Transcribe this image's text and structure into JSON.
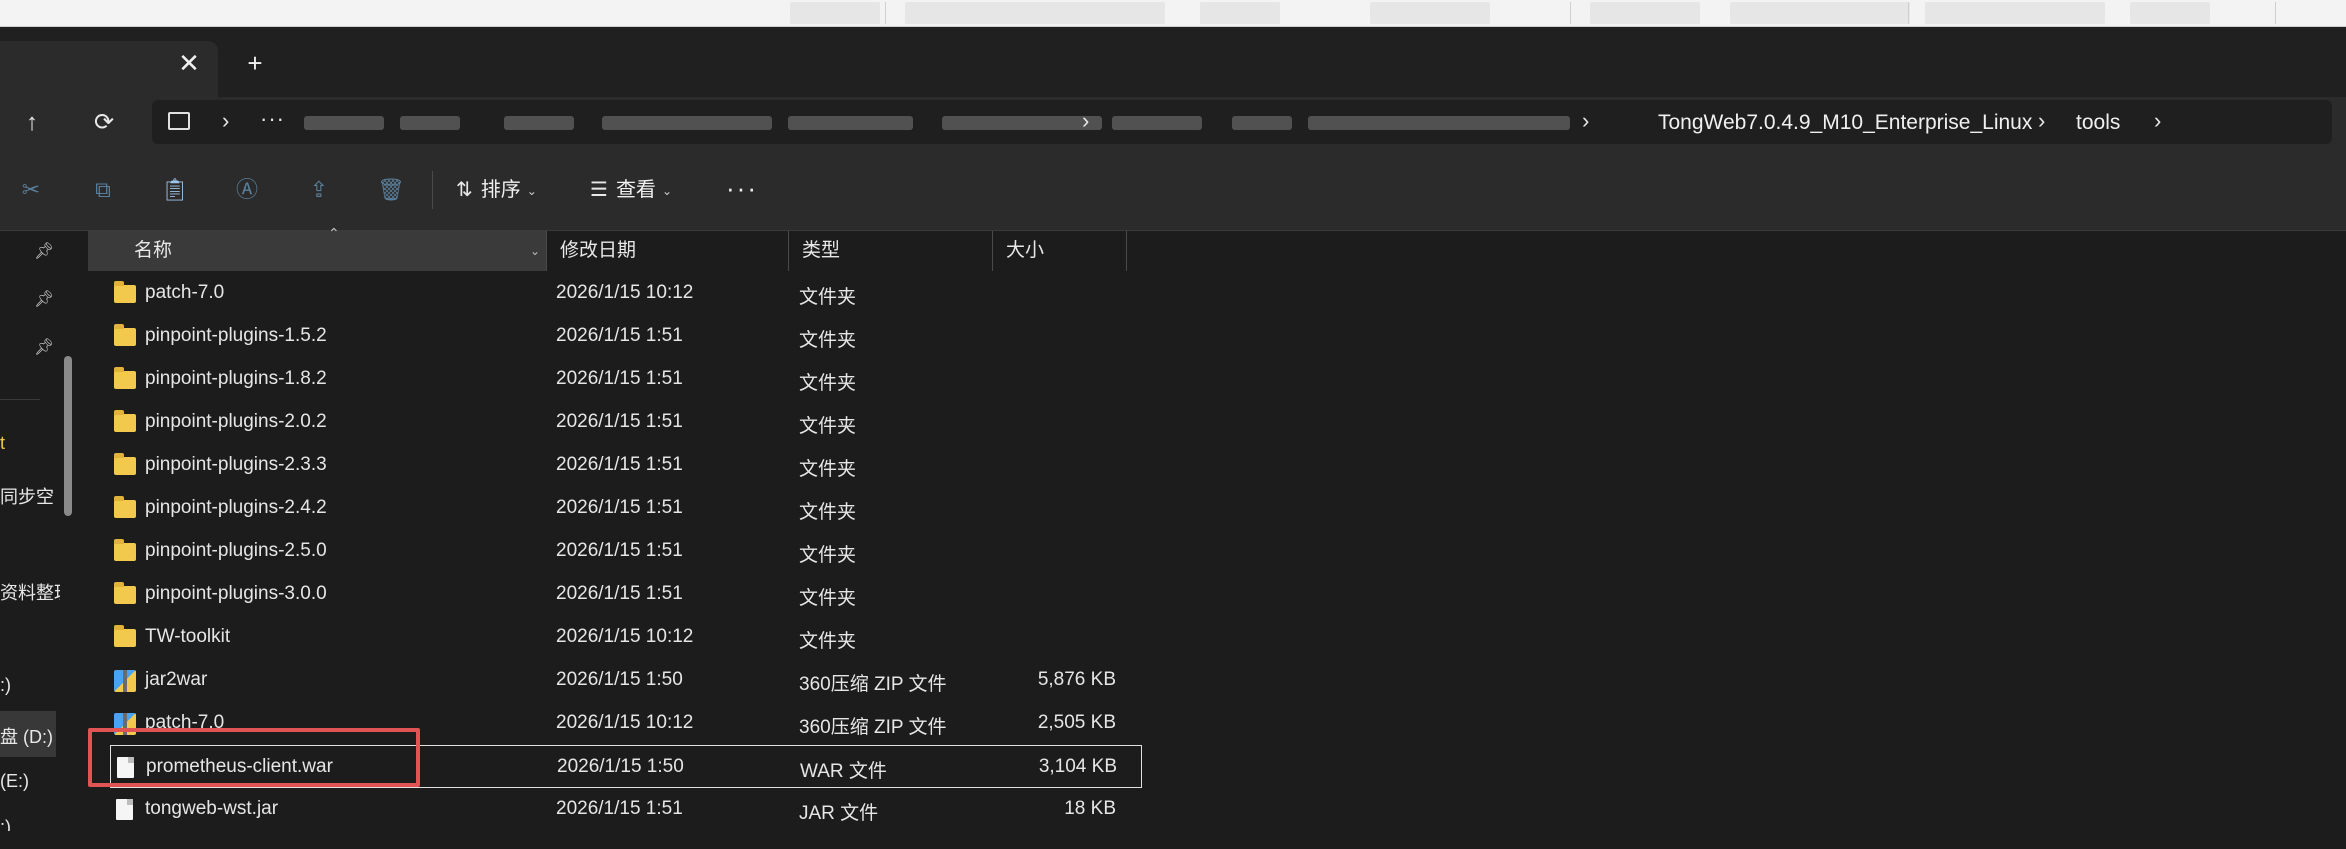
{
  "tabs": {
    "close_glyph": "✕",
    "new_tab_glyph": "+"
  },
  "address": {
    "dots": "···",
    "crumbs": [
      {
        "label": "TongWeb7.0.4.9_M10_Enterprise_Linux"
      },
      {
        "label": "tools"
      }
    ]
  },
  "toolbar": {
    "sort_label": "排序",
    "view_label": "查看",
    "more_glyph": "···"
  },
  "nav_pane": {
    "items": [
      {
        "label": "t"
      },
      {
        "label": "同步空"
      },
      {
        "label": "资料整理"
      },
      {
        "label": ":)"
      },
      {
        "label": "盘 (D:)"
      },
      {
        "label": "(E:)"
      },
      {
        "label": ":)"
      }
    ]
  },
  "columns": {
    "name": "名称",
    "date": "修改日期",
    "type": "类型",
    "size": "大小"
  },
  "files": [
    {
      "name": "patch-7.0",
      "date": "2026/1/15 10:12",
      "type": "文件夹",
      "size": "",
      "kind": "folder"
    },
    {
      "name": "pinpoint-plugins-1.5.2",
      "date": "2026/1/15 1:51",
      "type": "文件夹",
      "size": "",
      "kind": "folder"
    },
    {
      "name": "pinpoint-plugins-1.8.2",
      "date": "2026/1/15 1:51",
      "type": "文件夹",
      "size": "",
      "kind": "folder"
    },
    {
      "name": "pinpoint-plugins-2.0.2",
      "date": "2026/1/15 1:51",
      "type": "文件夹",
      "size": "",
      "kind": "folder"
    },
    {
      "name": "pinpoint-plugins-2.3.3",
      "date": "2026/1/15 1:51",
      "type": "文件夹",
      "size": "",
      "kind": "folder"
    },
    {
      "name": "pinpoint-plugins-2.4.2",
      "date": "2026/1/15 1:51",
      "type": "文件夹",
      "size": "",
      "kind": "folder"
    },
    {
      "name": "pinpoint-plugins-2.5.0",
      "date": "2026/1/15 1:51",
      "type": "文件夹",
      "size": "",
      "kind": "folder"
    },
    {
      "name": "pinpoint-plugins-3.0.0",
      "date": "2026/1/15 1:51",
      "type": "文件夹",
      "size": "",
      "kind": "folder"
    },
    {
      "name": "TW-toolkit",
      "date": "2026/1/15 10:12",
      "type": "文件夹",
      "size": "",
      "kind": "folder"
    },
    {
      "name": "jar2war",
      "date": "2026/1/15 1:50",
      "type": "360压缩 ZIP 文件",
      "size": "5,876 KB",
      "kind": "zip"
    },
    {
      "name": "patch-7.0",
      "date": "2026/1/15 10:12",
      "type": "360压缩 ZIP 文件",
      "size": "2,505 KB",
      "kind": "zip"
    },
    {
      "name": "prometheus-client.war",
      "date": "2026/1/15 1:50",
      "type": "WAR 文件",
      "size": "3,104 KB",
      "kind": "doc",
      "focused": true
    },
    {
      "name": "tongweb-wst.jar",
      "date": "2026/1/15 1:51",
      "type": "JAR 文件",
      "size": "18 KB",
      "kind": "doc"
    }
  ],
  "colors": {
    "background": "#1c1c1c",
    "folder": "#f2c94c",
    "highlight": "#e05454",
    "accent": "#9cc3e8"
  }
}
